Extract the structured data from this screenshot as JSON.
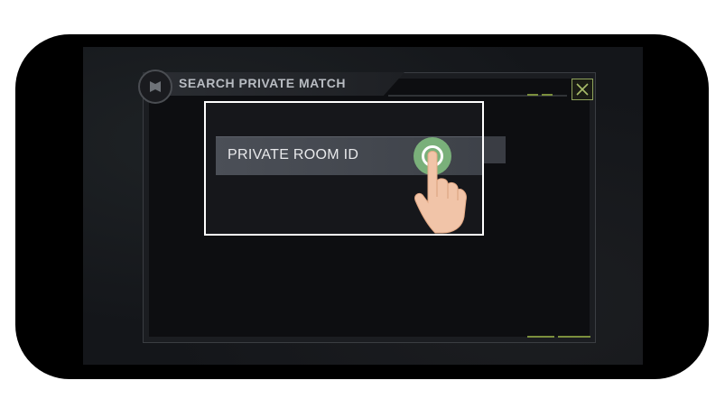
{
  "dialog": {
    "title": "SEARCH PRIVATE MATCH",
    "close_icon": "close-x-icon",
    "emblem_icon": "game-emblem-icon"
  },
  "highlight": {
    "field_label": "PRIVATE ROOM ID",
    "gesture_icon": "tap-hand-icon"
  },
  "colors": {
    "accent": "#7b8f3d",
    "tap": "#7ab07a",
    "highlight_border": "#ffffff"
  }
}
